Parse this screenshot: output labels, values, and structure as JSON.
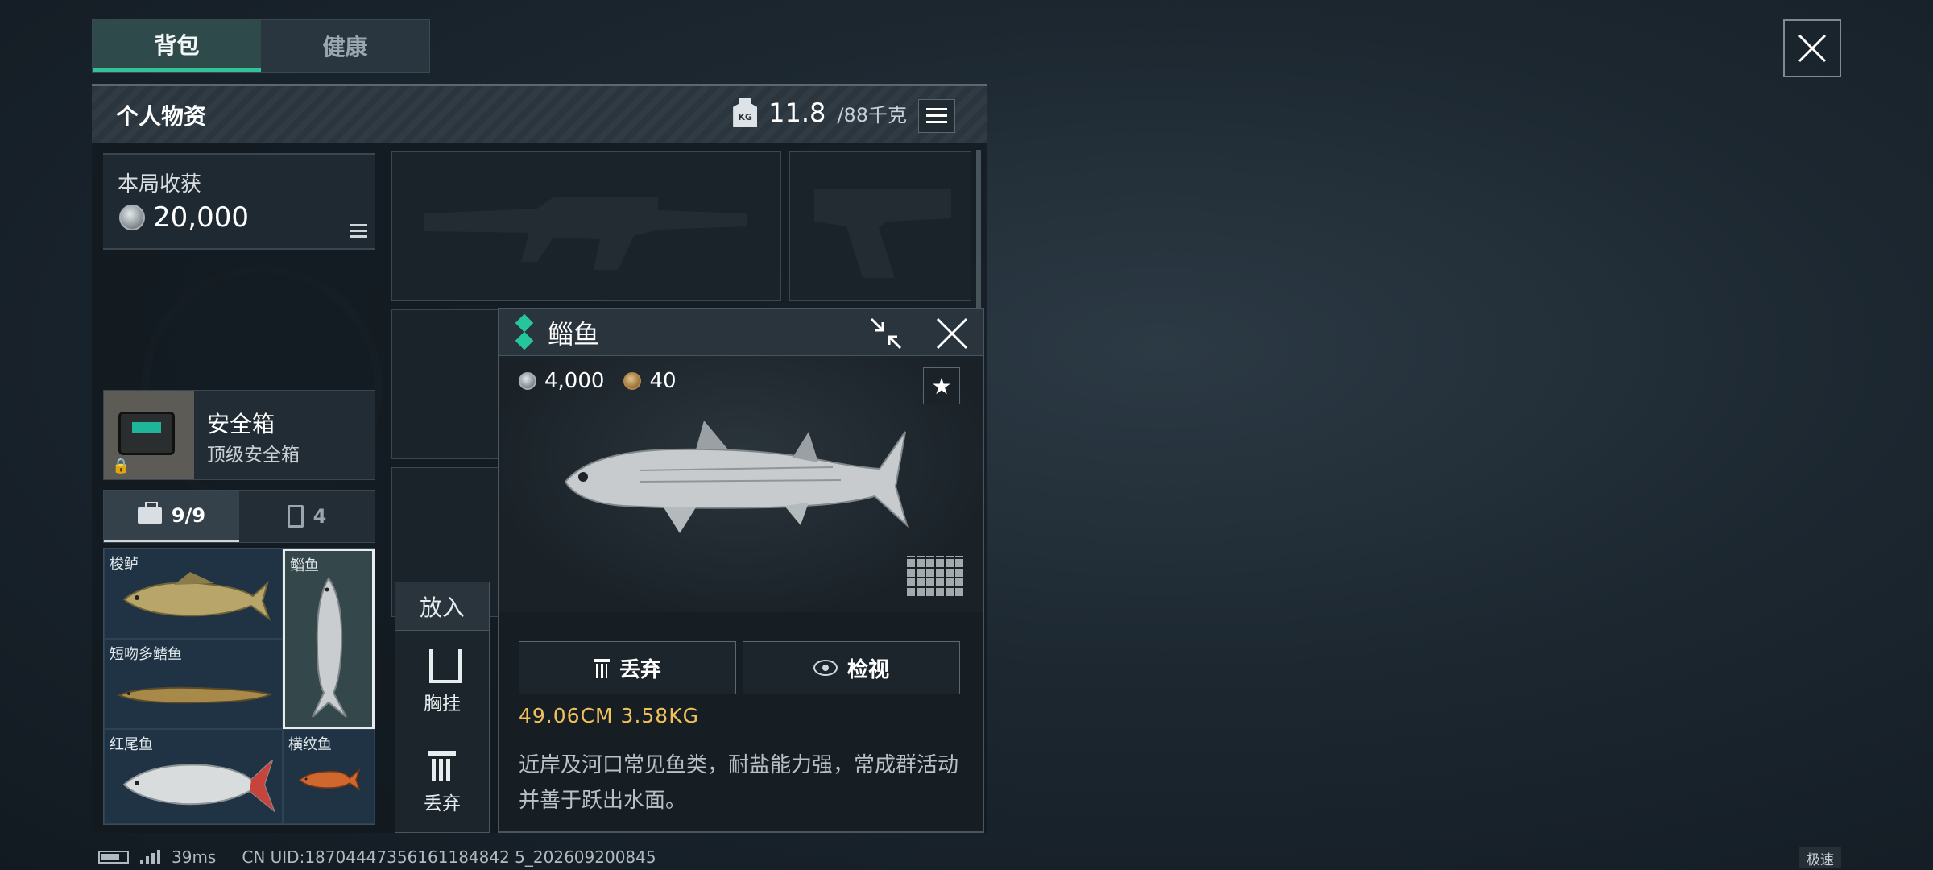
{
  "tabs": [
    {
      "label": "背包",
      "active": true
    },
    {
      "label": "健康",
      "active": false
    }
  ],
  "inventory": {
    "title": "个人物资",
    "weight_icon_text": "KG",
    "weight_current": "11.8",
    "weight_max": "/88千克"
  },
  "harvest": {
    "label": "本局收获",
    "value": "20,000"
  },
  "safe_box": {
    "title": "安全箱",
    "subtitle": "顶级安全箱"
  },
  "container_tabs": [
    {
      "label": "9/9",
      "icon": "briefcase-icon",
      "active": true
    },
    {
      "label": "4",
      "icon": "clipboard-icon",
      "active": false
    }
  ],
  "items": [
    {
      "name": "梭鲈"
    },
    {
      "name": "鲻鱼",
      "selected": true
    },
    {
      "name": "短吻多鳍鱼"
    },
    {
      "name": "红尾鱼"
    },
    {
      "name": "横纹鱼"
    }
  ],
  "action_menu": {
    "put_in": "放入",
    "chest_rig": "胸挂",
    "discard": "丢弃"
  },
  "detail": {
    "title": "鲻鱼",
    "price": "4,000",
    "secondary_price": "40",
    "discard_label": "丢弃",
    "inspect_label": "检视",
    "dimensions": "49.06CM  3.58KG",
    "description": "近岸及河口常见鱼类，耐盐能力强，常成群活动并善于跃出水面。",
    "rarity_color": "#26c69a"
  },
  "status_bar": {
    "ping": "39ms",
    "uid": "CN UID:18704447356161184842 5_202609200845",
    "speed_mode": "极速"
  }
}
